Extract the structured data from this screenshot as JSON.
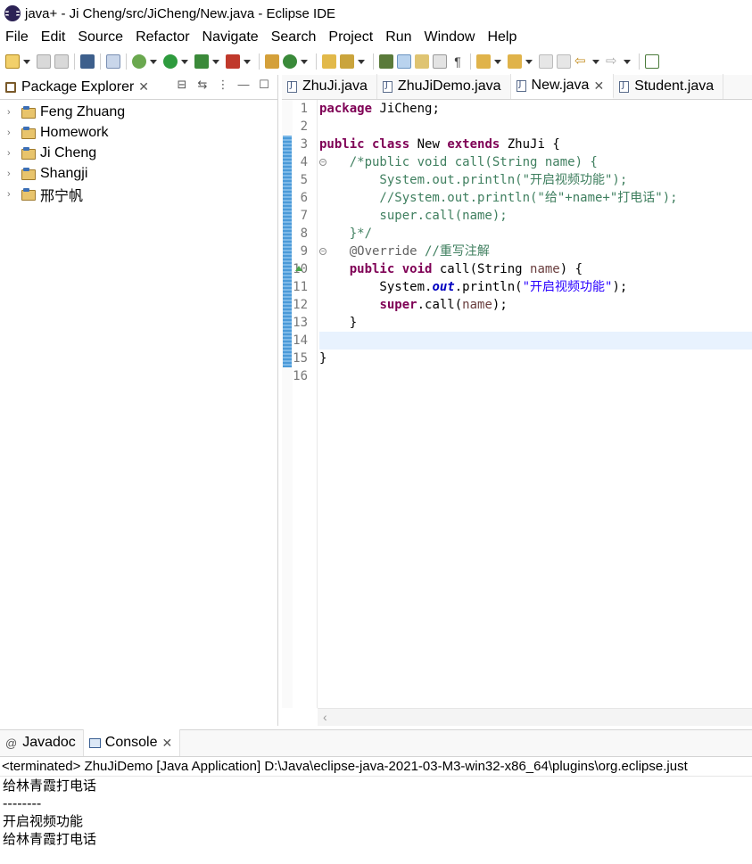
{
  "window": {
    "title": "java+ - Ji Cheng/src/JiCheng/New.java - Eclipse IDE"
  },
  "menubar": {
    "items": [
      "File",
      "Edit",
      "Source",
      "Refactor",
      "Navigate",
      "Search",
      "Project",
      "Run",
      "Window",
      "Help"
    ]
  },
  "package_explorer": {
    "tab_label": "Package Explorer",
    "projects": [
      "Feng Zhuang",
      "Homework",
      "Ji Cheng",
      "Shangji",
      "邢宁帆"
    ]
  },
  "editor": {
    "tabs": [
      {
        "label": "ZhuJi.java",
        "active": false
      },
      {
        "label": "ZhuJiDemo.java",
        "active": false
      },
      {
        "label": "New.java",
        "active": true
      },
      {
        "label": "Student.java",
        "active": false
      }
    ],
    "line_numbers": [
      "1",
      "2",
      "3",
      "4",
      "5",
      "6",
      "7",
      "8",
      "9",
      "10",
      "11",
      "12",
      "13",
      "14",
      "15",
      "16"
    ],
    "current_line": 14
  },
  "console": {
    "tabs": {
      "javadoc": "Javadoc",
      "console": "Console"
    },
    "header": "<terminated> ZhuJiDemo [Java Application] D:\\Java\\eclipse-java-2021-03-M3-win32-x86_64\\plugins\\org.eclipse.just",
    "output": [
      "给林青霞打电话",
      "--------",
      "开启视频功能",
      "给林青霞打电话"
    ]
  },
  "colors": {
    "keyword": "#7f0055",
    "comment": "#3f7f5f",
    "string": "#2a00ff",
    "field": "#0000c0",
    "current_line_bg": "#e8f2fe"
  }
}
